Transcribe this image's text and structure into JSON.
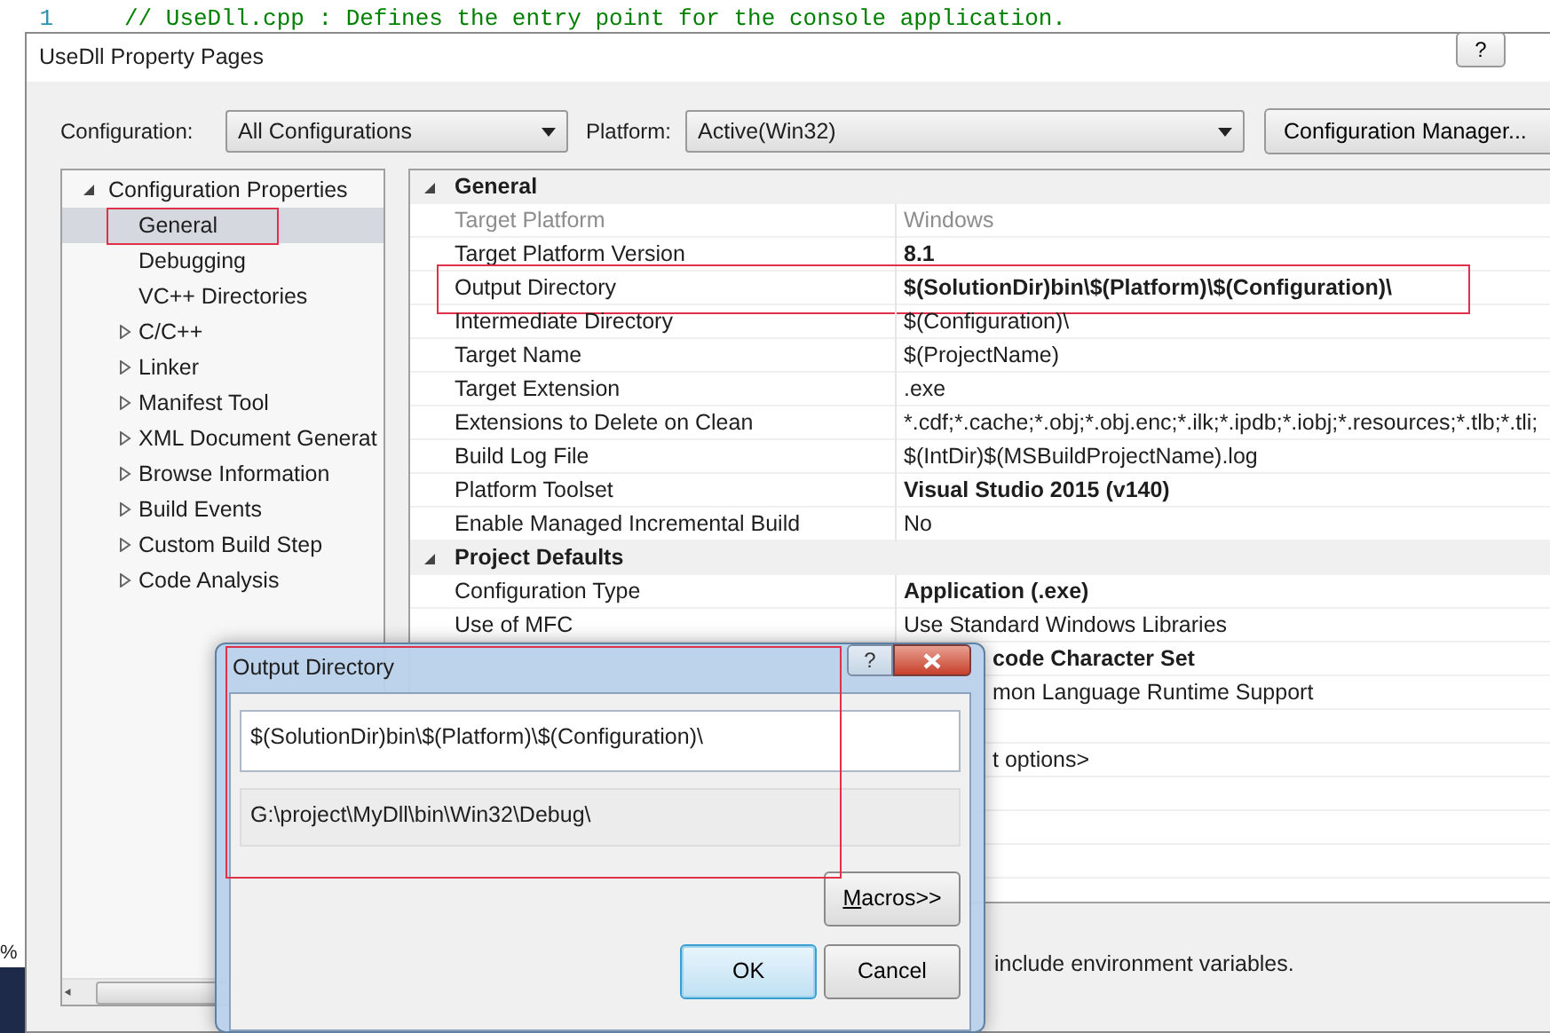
{
  "editor": {
    "line_number": "1",
    "text": "// UseDll.cpp : Defines the entry point for the console application."
  },
  "side_fragment": "%",
  "window": {
    "title": "UseDll Property Pages",
    "help": "?"
  },
  "toolbar": {
    "configuration_label": "Configuration:",
    "configuration": "All Configurations",
    "platform_label": "Platform:",
    "platform": "Active(Win32)",
    "manager_button": "Configuration Manager..."
  },
  "tree": [
    {
      "label": "Configuration Properties",
      "expanded": true,
      "selected": false,
      "children": [
        {
          "label": "General",
          "selected": true,
          "highlighted": true
        },
        {
          "label": "Debugging",
          "selected": false
        },
        {
          "label": "VC++ Directories",
          "selected": false
        },
        {
          "label": "C/C++",
          "expanded": false,
          "selected": false
        },
        {
          "label": "Linker",
          "expanded": false,
          "selected": false
        },
        {
          "label": "Manifest Tool",
          "expanded": false,
          "selected": false
        },
        {
          "label": "XML Document Generat",
          "expanded": false,
          "selected": false
        },
        {
          "label": "Browse Information",
          "expanded": false,
          "selected": false
        },
        {
          "label": "Build Events",
          "expanded": false,
          "selected": false
        },
        {
          "label": "Custom Build Step",
          "expanded": false,
          "selected": false
        },
        {
          "label": "Code Analysis",
          "expanded": false,
          "selected": false
        }
      ]
    }
  ],
  "properties": [
    {
      "kind": "category",
      "name": "General",
      "expanded": true
    },
    {
      "kind": "property",
      "name": "Target Platform",
      "value": "Windows",
      "disabled": true
    },
    {
      "kind": "property",
      "name": "Target Platform Version",
      "value": "8.1",
      "bold": true
    },
    {
      "kind": "property",
      "name": "Output Directory",
      "value": "$(SolutionDir)bin\\$(Platform)\\$(Configuration)\\",
      "bold": true,
      "highlighted": true
    },
    {
      "kind": "property",
      "name": "Intermediate Directory",
      "value": "$(Configuration)\\"
    },
    {
      "kind": "property",
      "name": "Target Name",
      "value": "$(ProjectName)"
    },
    {
      "kind": "property",
      "name": "Target Extension",
      "value": ".exe"
    },
    {
      "kind": "property",
      "name": "Extensions to Delete on Clean",
      "value": "*.cdf;*.cache;*.obj;*.obj.enc;*.ilk;*.ipdb;*.iobj;*.resources;*.tlb;*.tli;"
    },
    {
      "kind": "property",
      "name": "Build Log File",
      "value": "$(IntDir)$(MSBuildProjectName).log"
    },
    {
      "kind": "property",
      "name": "Platform Toolset",
      "value": "Visual Studio 2015 (v140)",
      "bold": true
    },
    {
      "kind": "property",
      "name": "Enable Managed Incremental Build",
      "value": "No"
    },
    {
      "kind": "category",
      "name": "Project Defaults",
      "expanded": true
    },
    {
      "kind": "property",
      "name": "Configuration Type",
      "value": "Application (.exe)",
      "bold": true
    },
    {
      "kind": "property",
      "name": "Use of MFC",
      "value": "Use Standard Windows Libraries"
    },
    {
      "kind": "covered",
      "value": "code Character Set",
      "bold": true
    },
    {
      "kind": "covered",
      "value": "mon Language Runtime Support"
    },
    {
      "kind": "spacer"
    },
    {
      "kind": "covered",
      "value": "t options>"
    }
  ],
  "description": "include environment variables.",
  "dialog": {
    "title": "Output Directory",
    "help": "?",
    "highlighted": true,
    "value": "$(SolutionDir)bin\\$(Platform)\\$(Configuration)\\",
    "evaluated": "G:\\project\\MyDll\\bin\\Win32\\Debug\\",
    "macros_button": {
      "label": "Macros>>",
      "mnemonic_underlined": true
    },
    "ok_button": {
      "label": "OK",
      "focused": true
    },
    "cancel_button": {
      "label": "Cancel"
    }
  }
}
